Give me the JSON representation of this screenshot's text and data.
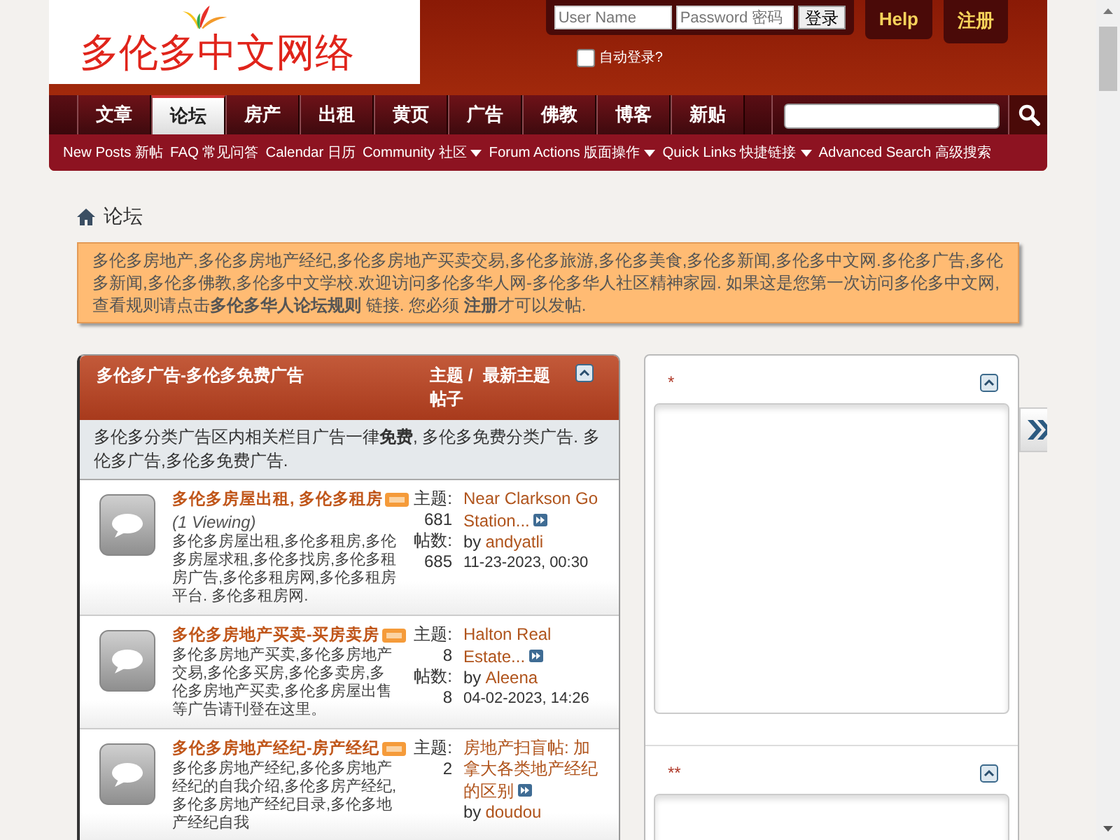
{
  "site": {
    "logo": "多伦多中文网络"
  },
  "login": {
    "username_placeholder": "User Name",
    "password_placeholder": "Password 密码",
    "login_button": "登录",
    "remember": {
      "label": "自动登录?",
      "checked": false
    }
  },
  "header_buttons": [
    "Help",
    "注册"
  ],
  "tabs": [
    {
      "label": "文章",
      "selected": false
    },
    {
      "label": "论坛",
      "selected": true
    },
    {
      "label": "房产",
      "selected": false
    },
    {
      "label": "出租",
      "selected": false
    },
    {
      "label": "黄页",
      "selected": false
    },
    {
      "label": "广告",
      "selected": false
    },
    {
      "label": "佛教",
      "selected": false
    },
    {
      "label": "博客",
      "selected": false
    },
    {
      "label": "新贴",
      "selected": false
    }
  ],
  "subnav": [
    {
      "label": "New Posts 新帖",
      "dropdown": false
    },
    {
      "label": "FAQ 常见问答",
      "dropdown": false
    },
    {
      "label": "Calendar 日历",
      "dropdown": false
    },
    {
      "label": "Community 社区",
      "dropdown": true
    },
    {
      "label": "Forum Actions 版面操作",
      "dropdown": true
    },
    {
      "label": "Quick Links 快捷链接",
      "dropdown": true
    },
    {
      "label": "Advanced Search 高级搜索",
      "dropdown": false
    }
  ],
  "breadcrumb": "论坛",
  "notice": "多伦多房地产,多伦多房地产经纪,多伦多房地产买卖交易,多伦多旅游,多伦多美食,多伦多新闻,多伦多中文网.多伦多广告,多伦多新闻,多伦多佛教,多伦多中文学校.欢迎访问多伦多华人网-多伦多华人社区精神家园. 如果这是您第一次访问多伦多中文网, 查看规则请点击**多伦多华人论坛规则** 链接. 您必须 **注册**才可以发帖.",
  "category": {
    "title": "多伦多广告-多伦多免费广告",
    "col_stats": "主题 / 帖子",
    "col_last": "最新主题",
    "description": "多伦多分类广告区内相关栏目广告一律**免费**, 多伦多免费分类广告. 多伦多广告,多伦多免费广告."
  },
  "forums": [
    {
      "title": "多伦多房屋出租, 多伦多租房",
      "viewing": "(1 Viewing)",
      "description": "多伦多房屋出租,多伦多租房,多伦多房屋求租,多伦多找房,多伦多租房广告,多伦多租房网,多伦多租房平台. 多伦多租房网.",
      "threads_label": "主题:",
      "threads": "681",
      "posts_label": "帖数:",
      "posts": "685",
      "last_title": "Near Clarkson Go Station...",
      "by_label": "by",
      "last_by": "andyatli",
      "last_date": "11-23-2023, 00:30"
    },
    {
      "title": "多伦多房地产买卖-买房卖房",
      "description": "多伦多房地产买卖,多伦多房地产交易,多伦多买房,多伦多卖房,多伦多房地产买卖,多伦多房屋出售等广告请刊登在这里。",
      "threads_label": "主题:",
      "threads": "8",
      "posts_label": "帖数:",
      "posts": "8",
      "last_title": "Halton Real Estate...",
      "by_label": "by",
      "last_by": "Aleena",
      "last_date": "04-02-2023, 14:26"
    },
    {
      "title": "多伦多房地产经纪-房产经纪",
      "description": "多伦多房地产经纪,多伦多房地产经纪的自我介绍,多伦多房产经纪,多伦多房地产经纪目录,多伦多地产经纪自我",
      "threads_label": "主题:",
      "threads": "2",
      "last_title": "房地产扫盲帖: 加拿大各类地产经纪的区别",
      "by_label": "by",
      "last_by": "doudou"
    }
  ],
  "sidebar_blocks": [
    {
      "title": "*"
    },
    {
      "title": "**"
    }
  ]
}
